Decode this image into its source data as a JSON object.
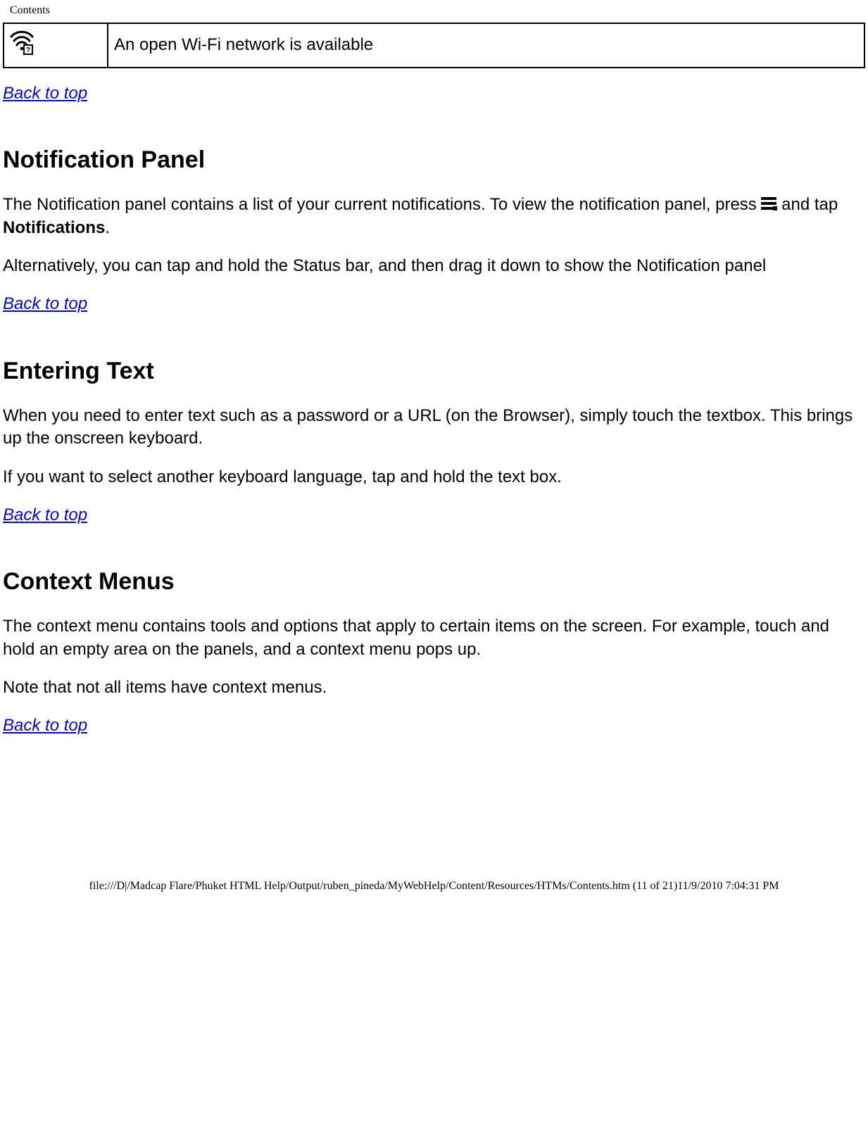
{
  "header": {
    "label": "Contents"
  },
  "notif_row": {
    "text": "An open Wi-Fi network is available"
  },
  "backlink": {
    "label": "Back to top"
  },
  "section_notif_panel": {
    "heading": "Notification Panel",
    "p1_pre": "The Notification panel contains a list of your current notifications. To view the notification panel, press ",
    "p1_post_a": " and tap ",
    "p1_bold": "Notifications",
    "p1_post_b": ".",
    "p2": "Alternatively, you can tap and hold the Status bar, and then drag it down to show the Notification panel"
  },
  "section_entering_text": {
    "heading": "Entering Text",
    "p1": "When you need to enter text such as a password or a URL (on the Browser), simply touch the textbox. This brings up the onscreen keyboard.",
    "p2": "If you want to select another keyboard language, tap and hold the text box."
  },
  "section_context_menus": {
    "heading": "Context Menus",
    "p1": "The context menu contains tools and options that apply to certain items on the screen. For example, touch and hold an empty area on the panels, and a context menu pops up.",
    "p2": "Note that not all items have context menus."
  },
  "footer": {
    "path": "file:///D|/Madcap Flare/Phuket HTML Help/Output/ruben_pineda/MyWebHelp/Content/Resources/HTMs/Contents.htm (11 of 21)11/9/2010 7:04:31 PM"
  }
}
